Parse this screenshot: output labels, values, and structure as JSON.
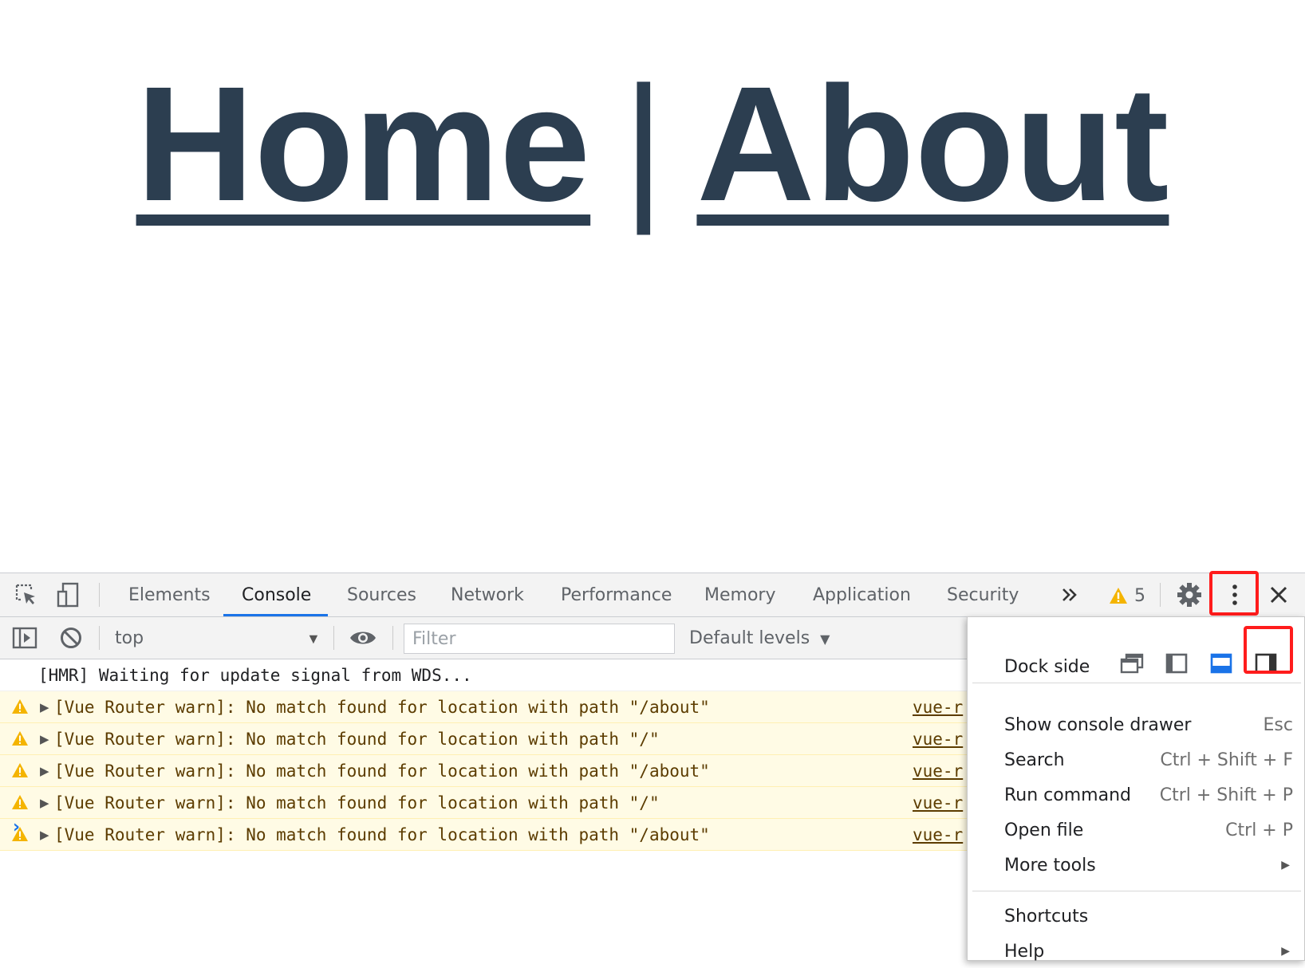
{
  "page": {
    "nav": {
      "home": "Home",
      "separator": "|",
      "about": "About"
    }
  },
  "devtools": {
    "tabs": [
      "Elements",
      "Console",
      "Sources",
      "Network",
      "Performance",
      "Memory",
      "Application",
      "Security"
    ],
    "active_tab": "Console",
    "more_tabs_icon": "double-chevron-right",
    "warning_count": "5",
    "toolbar": {
      "context": "top",
      "filter_placeholder": "Filter",
      "levels": "Default levels"
    },
    "console": {
      "info_message": "[HMR] Waiting for update signal from WDS...",
      "warnings": [
        {
          "text": "[Vue Router warn]: No match found for location with path \"/about\"",
          "source": "vue-r"
        },
        {
          "text": "[Vue Router warn]: No match found for location with path \"/\"",
          "source": "vue-r"
        },
        {
          "text": "[Vue Router warn]: No match found for location with path \"/about\"",
          "source": "vue-r"
        },
        {
          "text": "[Vue Router warn]: No match found for location with path \"/\"",
          "source": "vue-r"
        },
        {
          "text": "[Vue Router warn]: No match found for location with path \"/about\"",
          "source": "vue-r"
        }
      ],
      "prompt": "›"
    },
    "menu": {
      "dock_side_label": "Dock side",
      "items": [
        {
          "label": "Show console drawer",
          "shortcut": "Esc"
        },
        {
          "label": "Search",
          "shortcut": "Ctrl + Shift + F"
        },
        {
          "label": "Run command",
          "shortcut": "Ctrl + Shift + P"
        },
        {
          "label": "Open file",
          "shortcut": "Ctrl + P"
        },
        {
          "label": "More tools",
          "shortcut": ""
        }
      ],
      "footer_items": [
        {
          "label": "Shortcuts"
        },
        {
          "label": "Help"
        }
      ]
    }
  },
  "colors": {
    "nav_text": "#2c3e50",
    "accent_blue": "#1a73e8",
    "highlight_red": "#ff1c1c",
    "warning_bg": "#fffbe5",
    "warning_icon": "#f4b400"
  }
}
